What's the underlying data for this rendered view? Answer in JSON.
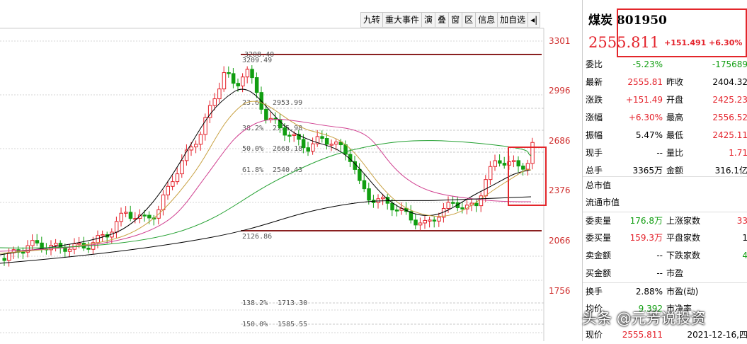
{
  "toolbar": [
    "九转",
    "重大事件",
    "演",
    "叠",
    "窗",
    "区",
    "信息",
    "加自选"
  ],
  "pin_icon": "pin-icon",
  "y_axis": [
    "3301",
    "2996",
    "2686",
    "2376",
    "2066",
    "1756"
  ],
  "fib_labels": {
    "top": "3209.49",
    "top_left": "3208.40",
    "f236": "23.6%",
    "v236": "2953.99",
    "f382": "38.2%",
    "v382": "2795.98",
    "f500": "50.0%",
    "v500": "2668.18",
    "f618": "61.8%",
    "v618": "2540.43",
    "bottom": "2126.86",
    "f1382": "138.2%",
    "v1382": "1713.30",
    "f1500": "150.0%",
    "v1500": "1585.55"
  },
  "header": {
    "name": "煤炭 801950",
    "price": "2555.811",
    "change": "+151.491",
    "pct": "+6.30%"
  },
  "rows": [
    {
      "l": "委比",
      "v": "-5.23%",
      "vc": "green",
      "v2": "-175689",
      "v2c": "green",
      "single": false,
      "split": true
    },
    {
      "l": "最新",
      "v": "2555.81",
      "vc": "red",
      "l2": "昨收",
      "v2": "2404.32",
      "v2c": "black"
    },
    {
      "l": "涨跌",
      "v": "+151.49",
      "vc": "red",
      "l2": "开盘",
      "v2": "2425.23",
      "v2c": "red"
    },
    {
      "l": "涨幅",
      "v": "+6.30%",
      "vc": "red",
      "l2": "最高",
      "v2": "2556.52",
      "v2c": "red"
    },
    {
      "l": "振幅",
      "v": "5.47%",
      "vc": "black",
      "l2": "最低",
      "v2": "2425.11",
      "v2c": "red"
    },
    {
      "l": "现手",
      "v": "--",
      "vc": "black",
      "l2": "量比",
      "v2": "1.71",
      "v2c": "red"
    },
    {
      "l": "总手",
      "v": "3365万",
      "vc": "black",
      "l2": "金额",
      "v2": "316.1亿",
      "v2c": "black"
    },
    {
      "l": "总市值",
      "v": "",
      "vc": "black",
      "l2": "",
      "v2": "",
      "v2c": "black",
      "sep": true
    },
    {
      "l": "流通市值",
      "v": "",
      "vc": "black",
      "l2": "",
      "v2": "",
      "v2c": "black"
    },
    {
      "l": "委卖量",
      "v": "176.8万",
      "vc": "green",
      "l2": "上涨家数",
      "v2": "33",
      "v2c": "red",
      "sep": true
    },
    {
      "l": "委买量",
      "v": "159.3万",
      "vc": "red",
      "l2": "平盘家数",
      "v2": "1",
      "v2c": "black"
    },
    {
      "l": "卖金额",
      "v": "--",
      "vc": "black",
      "l2": "下跌家数",
      "v2": "4",
      "v2c": "green"
    },
    {
      "l": "买金额",
      "v": "--",
      "vc": "black",
      "l2": "市盈",
      "v2": "",
      "v2c": "black"
    },
    {
      "l": "换手",
      "v": "2.88%",
      "vc": "black",
      "l2": "市盈(动)",
      "v2": "",
      "v2c": "black",
      "sep": true
    },
    {
      "l": "均价",
      "v": "9.392",
      "vc": "green",
      "l2": "市净率",
      "v2": "",
      "v2c": "black"
    },
    {
      "l": "现价",
      "v": "2555.811",
      "vc": "red",
      "l2": "",
      "v2": "2021-12-16,四",
      "v2c": "black"
    }
  ],
  "watermark": "头条 @元芳说投资",
  "colors": {
    "up": "#e4222b",
    "down": "#119e11",
    "ma5": "#000000",
    "ma10": "#c8a040",
    "ma20": "#d04090",
    "ma60": "#22a030",
    "ma120": "#000000"
  }
}
